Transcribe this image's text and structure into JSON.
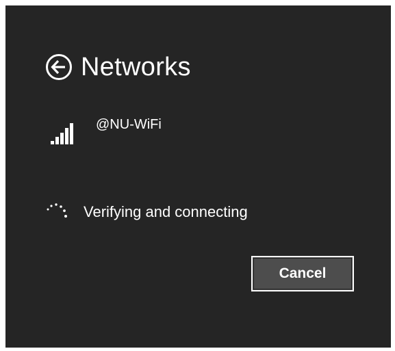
{
  "header": {
    "title": "Networks",
    "back_icon": "back-arrow-circle-icon"
  },
  "network": {
    "name": "@NU-WiFi",
    "signal_icon": "wifi-signal-bars-icon",
    "signal_strength": "5/5"
  },
  "status": {
    "text": "Verifying and connecting",
    "icon": "loading-spinner-icon"
  },
  "actions": {
    "cancel_label": "Cancel"
  },
  "colors": {
    "background": "#252525",
    "text": "#ffffff",
    "button_fill": "#4d4d4d",
    "button_border": "#ffffff"
  }
}
